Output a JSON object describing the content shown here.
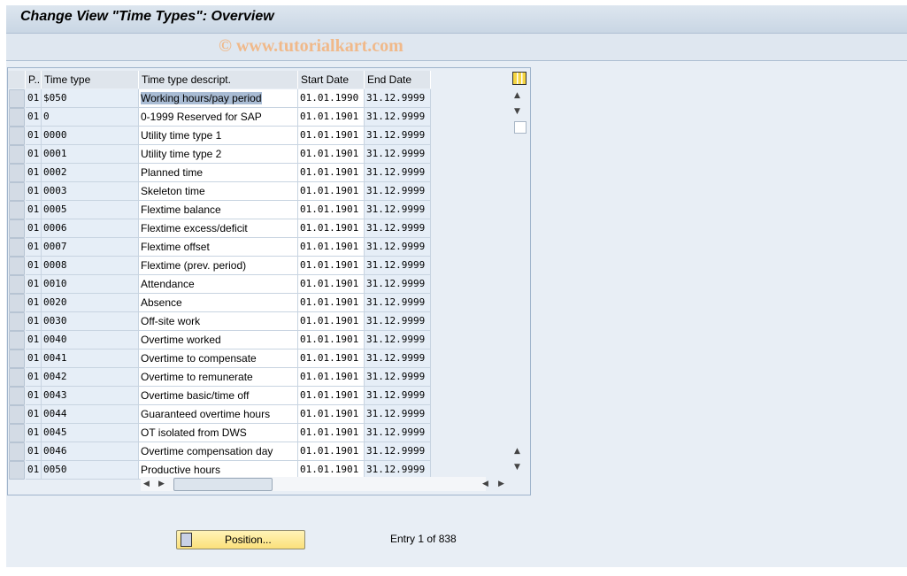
{
  "title": "Change View \"Time Types\": Overview",
  "watermark": "© www.tutorialkart.com",
  "table": {
    "columns": [
      "P..",
      "Time type",
      "Time type descript.",
      "Start Date",
      "End Date"
    ],
    "rows": [
      [
        "01",
        "$050",
        "Working hours/pay period",
        "01.01.1990",
        "31.12.9999"
      ],
      [
        "01",
        "0",
        "0-1999 Reserved for SAP",
        "01.01.1901",
        "31.12.9999"
      ],
      [
        "01",
        "0000",
        "Utility time type 1",
        "01.01.1901",
        "31.12.9999"
      ],
      [
        "01",
        "0001",
        "Utility time type 2",
        "01.01.1901",
        "31.12.9999"
      ],
      [
        "01",
        "0002",
        "Planned time",
        "01.01.1901",
        "31.12.9999"
      ],
      [
        "01",
        "0003",
        "Skeleton time",
        "01.01.1901",
        "31.12.9999"
      ],
      [
        "01",
        "0005",
        "Flextime balance",
        "01.01.1901",
        "31.12.9999"
      ],
      [
        "01",
        "0006",
        "Flextime excess/deficit",
        "01.01.1901",
        "31.12.9999"
      ],
      [
        "01",
        "0007",
        "Flextime offset",
        "01.01.1901",
        "31.12.9999"
      ],
      [
        "01",
        "0008",
        "Flextime (prev. period)",
        "01.01.1901",
        "31.12.9999"
      ],
      [
        "01",
        "0010",
        "Attendance",
        "01.01.1901",
        "31.12.9999"
      ],
      [
        "01",
        "0020",
        "Absence",
        "01.01.1901",
        "31.12.9999"
      ],
      [
        "01",
        "0030",
        "Off-site work",
        "01.01.1901",
        "31.12.9999"
      ],
      [
        "01",
        "0040",
        "Overtime worked",
        "01.01.1901",
        "31.12.9999"
      ],
      [
        "01",
        "0041",
        "Overtime to compensate",
        "01.01.1901",
        "31.12.9999"
      ],
      [
        "01",
        "0042",
        "Overtime to remunerate",
        "01.01.1901",
        "31.12.9999"
      ],
      [
        "01",
        "0043",
        "Overtime basic/time off",
        "01.01.1901",
        "31.12.9999"
      ],
      [
        "01",
        "0044",
        "Guaranteed overtime hours",
        "01.01.1901",
        "31.12.9999"
      ],
      [
        "01",
        "0045",
        "OT isolated from DWS",
        "01.01.1901",
        "31.12.9999"
      ],
      [
        "01",
        "0046",
        "Overtime compensation day",
        "01.01.1901",
        "31.12.9999"
      ],
      [
        "01",
        "0050",
        "Productive hours",
        "01.01.1901",
        "31.12.9999"
      ]
    ]
  },
  "position_button": "Position...",
  "entry_text": "Entry 1 of 838"
}
